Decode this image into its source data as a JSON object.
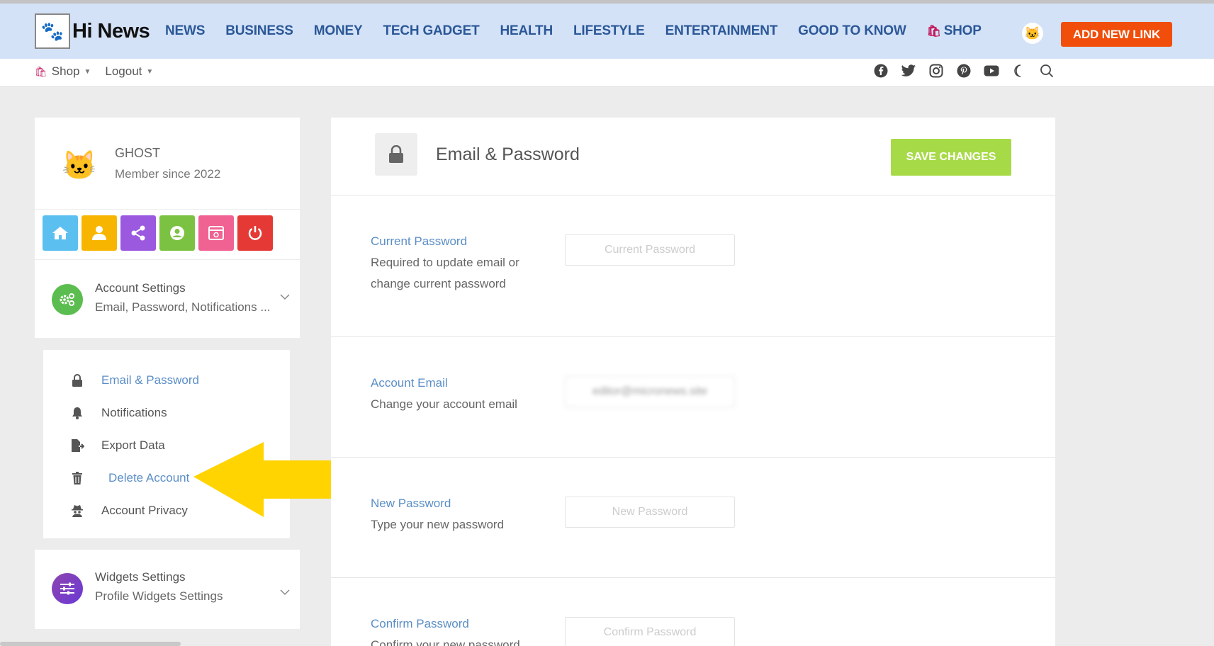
{
  "header": {
    "logo_text": "Hi News",
    "nav": [
      "NEWS",
      "BUSINESS",
      "MONEY",
      "TECH GADGET",
      "HEALTH",
      "LIFESTYLE",
      "ENTERTAINMENT",
      "GOOD TO KNOW",
      "SHOP"
    ],
    "add_link_label": "ADD NEW LINK"
  },
  "subbar": {
    "shop_label": "Shop",
    "logout_label": "Logout",
    "social_icons": [
      "facebook-icon",
      "twitter-icon",
      "instagram-icon",
      "pinterest-icon",
      "youtube-icon"
    ]
  },
  "profile": {
    "username": "GHOST",
    "member_since": "Member since 2022"
  },
  "quick_actions": [
    {
      "icon": "home-icon",
      "color": "#5bc0f0"
    },
    {
      "icon": "user-icon",
      "color": "#f7b500"
    },
    {
      "icon": "share-icon",
      "color": "#9b59e0"
    },
    {
      "icon": "account-circle-icon",
      "color": "#7cc242"
    },
    {
      "icon": "browser-icon",
      "color": "#f06292"
    },
    {
      "icon": "power-icon",
      "color": "#e53935"
    }
  ],
  "account_settings": {
    "title": "Account Settings",
    "subtitle": "Email, Password, Notifications ..."
  },
  "submenu": {
    "items": [
      "Email & Password",
      "Notifications",
      "Export Data",
      "Delete Account",
      "Account Privacy"
    ]
  },
  "widgets_settings": {
    "title": "Widgets Settings",
    "subtitle": "Profile Widgets Settings"
  },
  "main": {
    "title": "Email & Password",
    "save_label": "SAVE CHANGES",
    "sections": [
      {
        "label": "Current Password",
        "help": "Required to update email or change current password",
        "placeholder": "Current Password",
        "value": ""
      },
      {
        "label": "Account Email",
        "help": "Change your account email",
        "placeholder": "",
        "value": "editor@micronews.site"
      },
      {
        "label": "New Password",
        "help": "Type your new password",
        "placeholder": "New Password",
        "value": ""
      },
      {
        "label": "Confirm Password",
        "help": "Confirm your new password",
        "placeholder": "Confirm Password",
        "value": ""
      }
    ]
  },
  "colors": {
    "topbar_bg": "#d3e2f7",
    "nav_text": "#2b5797",
    "add_link_bg": "#f04e0a",
    "save_bg": "#a7da47",
    "accent_blue": "#5b8ec6",
    "annotation_arrow": "#ffd400"
  }
}
